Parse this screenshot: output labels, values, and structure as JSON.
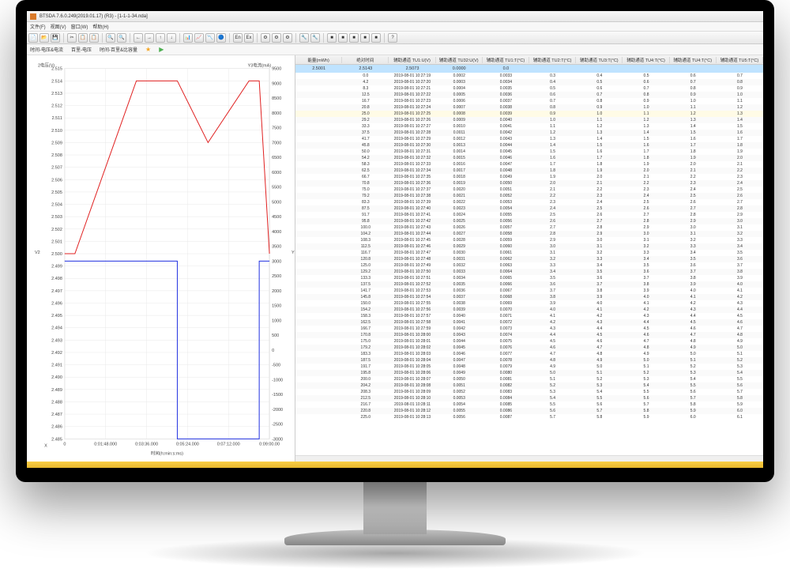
{
  "window": {
    "title": "BTSDA 7.6.0.249(2019.01.17) (R3) - [1-1-1-34.nda]"
  },
  "menus": [
    "文件(F)",
    "视图(V)",
    "窗口(W)",
    "帮助(H)"
  ],
  "subbar": {
    "a": "时间-电压&电流",
    "b": "百里-电压",
    "c": "时间-百里&比容量"
  },
  "chart": {
    "y2_title": "2电压(V)",
    "y3_title": "Y3电流(mA)",
    "x_title": "时间(h:min:s:ms)",
    "v2": "V2",
    "v3": "Y3",
    "x": "X",
    "x_ticks": [
      "0",
      "0:01:48.000",
      "0:03:36.000",
      "0:05:24.000",
      "0:07:12.000",
      "0:09:00.00"
    ],
    "y2_ticks": [
      "2.485",
      "2.486",
      "2.487",
      "2.488",
      "2.489",
      "2.490",
      "2.491",
      "2.492",
      "2.493",
      "2.494",
      "2.495",
      "2.496",
      "2.497",
      "2.498",
      "2.499",
      "2.500",
      "2.501",
      "2.502",
      "2.503",
      "2.504",
      "2.505",
      "2.506",
      "2.507",
      "2.508",
      "2.509",
      "2.510",
      "2.511",
      "2.512",
      "2.513",
      "2.514",
      "2.515"
    ],
    "y3_ticks": [
      "-3000",
      "-2500",
      "-2000",
      "-1500",
      "-1000",
      "-500",
      "0",
      "500",
      "1000",
      "1500",
      "2000",
      "2500",
      "3000",
      "3500",
      "4000",
      "4500",
      "5000",
      "5500",
      "6000",
      "6500",
      "7000",
      "7500",
      "8000",
      "8500",
      "9000",
      "9500"
    ]
  },
  "chart_data": {
    "type": "line",
    "x": [
      0,
      0.05,
      0.35,
      0.55,
      0.7,
      0.9,
      0.95,
      1.0
    ],
    "series": [
      {
        "name": "电压(V)",
        "y": [
          2.5,
          2.5,
          2.514,
          2.514,
          2.509,
          2.514,
          2.514,
          2.5
        ],
        "axis": "left",
        "color": "#e02020"
      },
      {
        "name": "电流(mA)",
        "y": [
          3000,
          3000,
          3000,
          -3000,
          -3000,
          -3000,
          3000,
          3000
        ],
        "axis": "right",
        "color": "#2030e0",
        "shape": "step"
      }
    ],
    "y_left": {
      "min": 2.485,
      "max": 2.515,
      "label": "电压(V)"
    },
    "y_right": {
      "min": -3000,
      "max": 9500,
      "label": "电流(mA)"
    },
    "xlim": [
      0,
      1
    ],
    "xlabel": "时间(h:min:s:ms)"
  },
  "table": {
    "headers": [
      "能量(mWh)",
      "绝对时间",
      "辅助通道 TU1:U(V)",
      "辅助通道 TU32:U(V)",
      "辅助通道 TU1:T(°C)",
      "辅助通道 TU2:T(°C)",
      "辅助通道 TU3:T(°C)",
      "辅助通道 TU4:T(°C)",
      "辅助通道 TU4:T(°C)",
      "辅助通道 TU5:T(°C)"
    ],
    "summary": [
      "2.5001",
      "2.5143",
      "2.5073",
      "0.0000",
      "0.0",
      "",
      "",
      "",
      "",
      ""
    ],
    "hl_index": 6,
    "rows": [
      [
        "0.0",
        "2019-08-01 10:27:19",
        "0.0002",
        "0.0033",
        "0.3",
        "0.4",
        "0.5",
        "0.6",
        "0.7"
      ],
      [
        "4.2",
        "2019-08-01 10:27:20",
        "0.0003",
        "0.0034",
        "0.4",
        "0.5",
        "0.6",
        "0.7",
        "0.8"
      ],
      [
        "8.3",
        "2019-08-01 10:27:21",
        "0.0004",
        "0.0035",
        "0.5",
        "0.6",
        "0.7",
        "0.8",
        "0.9"
      ],
      [
        "12.5",
        "2019-08-01 10:27:22",
        "0.0005",
        "0.0036",
        "0.6",
        "0.7",
        "0.8",
        "0.9",
        "1.0"
      ],
      [
        "16.7",
        "2019-08-01 10:27:23",
        "0.0006",
        "0.0037",
        "0.7",
        "0.8",
        "0.9",
        "1.0",
        "1.1"
      ],
      [
        "20.8",
        "2019-08-01 10:27:24",
        "0.0007",
        "0.0038",
        "0.8",
        "0.9",
        "1.0",
        "1.1",
        "1.2"
      ],
      [
        "25.0",
        "2019-08-01 10:27:25",
        "0.0008",
        "0.0039",
        "0.9",
        "1.0",
        "1.1",
        "1.2",
        "1.3"
      ],
      [
        "29.2",
        "2019-08-01 10:27:26",
        "0.0009",
        "0.0040",
        "1.0",
        "1.1",
        "1.2",
        "1.3",
        "1.4"
      ],
      [
        "33.3",
        "2019-08-01 10:27:27",
        "0.0010",
        "0.0041",
        "1.1",
        "1.2",
        "1.3",
        "1.4",
        "1.5"
      ],
      [
        "37.5",
        "2019-08-01 10:27:28",
        "0.0011",
        "0.0042",
        "1.2",
        "1.3",
        "1.4",
        "1.5",
        "1.6"
      ],
      [
        "41.7",
        "2019-08-01 10:27:29",
        "0.0012",
        "0.0043",
        "1.3",
        "1.4",
        "1.5",
        "1.6",
        "1.7"
      ],
      [
        "45.8",
        "2019-08-01 10:27:30",
        "0.0013",
        "0.0044",
        "1.4",
        "1.5",
        "1.6",
        "1.7",
        "1.8"
      ],
      [
        "50.0",
        "2019-08-01 10:27:31",
        "0.0014",
        "0.0045",
        "1.5",
        "1.6",
        "1.7",
        "1.8",
        "1.9"
      ],
      [
        "54.2",
        "2019-08-01 10:27:32",
        "0.0015",
        "0.0046",
        "1.6",
        "1.7",
        "1.8",
        "1.9",
        "2.0"
      ],
      [
        "58.3",
        "2019-08-01 10:27:33",
        "0.0016",
        "0.0047",
        "1.7",
        "1.8",
        "1.9",
        "2.0",
        "2.1"
      ],
      [
        "62.5",
        "2019-08-01 10:27:34",
        "0.0017",
        "0.0048",
        "1.8",
        "1.9",
        "2.0",
        "2.1",
        "2.2"
      ],
      [
        "66.7",
        "2019-08-01 10:27:35",
        "0.0018",
        "0.0049",
        "1.9",
        "2.0",
        "2.1",
        "2.2",
        "2.3"
      ],
      [
        "70.8",
        "2019-08-01 10:27:36",
        "0.0019",
        "0.0050",
        "2.0",
        "2.1",
        "2.2",
        "2.3",
        "2.4"
      ],
      [
        "75.0",
        "2019-08-01 10:27:37",
        "0.0020",
        "0.0051",
        "2.1",
        "2.2",
        "2.3",
        "2.4",
        "2.5"
      ],
      [
        "79.2",
        "2019-08-01 10:27:38",
        "0.0021",
        "0.0052",
        "2.2",
        "2.3",
        "2.4",
        "2.5",
        "2.6"
      ],
      [
        "83.3",
        "2019-08-01 10:27:39",
        "0.0022",
        "0.0053",
        "2.3",
        "2.4",
        "2.5",
        "2.6",
        "2.7"
      ],
      [
        "87.5",
        "2019-08-01 10:27:40",
        "0.0023",
        "0.0054",
        "2.4",
        "2.5",
        "2.6",
        "2.7",
        "2.8"
      ],
      [
        "91.7",
        "2019-08-01 10:27:41",
        "0.0024",
        "0.0055",
        "2.5",
        "2.6",
        "2.7",
        "2.8",
        "2.9"
      ],
      [
        "95.8",
        "2019-08-01 10:27:42",
        "0.0025",
        "0.0056",
        "2.6",
        "2.7",
        "2.8",
        "2.9",
        "3.0"
      ],
      [
        "100.0",
        "2019-08-01 10:27:43",
        "0.0026",
        "0.0057",
        "2.7",
        "2.8",
        "2.9",
        "3.0",
        "3.1"
      ],
      [
        "104.2",
        "2019-08-01 10:27:44",
        "0.0027",
        "0.0058",
        "2.8",
        "2.9",
        "3.0",
        "3.1",
        "3.2"
      ],
      [
        "108.3",
        "2019-08-01 10:27:45",
        "0.0028",
        "0.0059",
        "2.9",
        "3.0",
        "3.1",
        "3.2",
        "3.3"
      ],
      [
        "112.5",
        "2019-08-01 10:27:46",
        "0.0029",
        "0.0060",
        "3.0",
        "3.1",
        "3.2",
        "3.3",
        "3.4"
      ],
      [
        "116.7",
        "2019-08-01 10:27:47",
        "0.0030",
        "0.0061",
        "3.1",
        "3.2",
        "3.3",
        "3.4",
        "3.5"
      ],
      [
        "120.8",
        "2019-08-01 10:27:48",
        "0.0031",
        "0.0062",
        "3.2",
        "3.3",
        "3.4",
        "3.5",
        "3.6"
      ],
      [
        "125.0",
        "2019-08-01 10:27:49",
        "0.0032",
        "0.0063",
        "3.3",
        "3.4",
        "3.5",
        "3.6",
        "3.7"
      ],
      [
        "129.2",
        "2019-08-01 10:27:50",
        "0.0033",
        "0.0064",
        "3.4",
        "3.5",
        "3.6",
        "3.7",
        "3.8"
      ],
      [
        "133.3",
        "2019-08-01 10:27:51",
        "0.0034",
        "0.0065",
        "3.5",
        "3.6",
        "3.7",
        "3.8",
        "3.9"
      ],
      [
        "137.5",
        "2019-08-01 10:27:52",
        "0.0035",
        "0.0066",
        "3.6",
        "3.7",
        "3.8",
        "3.9",
        "4.0"
      ],
      [
        "141.7",
        "2019-08-01 10:27:53",
        "0.0036",
        "0.0067",
        "3.7",
        "3.8",
        "3.9",
        "4.0",
        "4.1"
      ],
      [
        "145.8",
        "2019-08-01 10:27:54",
        "0.0037",
        "0.0068",
        "3.8",
        "3.9",
        "4.0",
        "4.1",
        "4.2"
      ],
      [
        "150.0",
        "2019-08-01 10:27:55",
        "0.0038",
        "0.0069",
        "3.9",
        "4.0",
        "4.1",
        "4.2",
        "4.3"
      ],
      [
        "154.2",
        "2019-08-01 10:27:56",
        "0.0039",
        "0.0070",
        "4.0",
        "4.1",
        "4.2",
        "4.3",
        "4.4"
      ],
      [
        "158.3",
        "2019-08-01 10:27:57",
        "0.0040",
        "0.0071",
        "4.1",
        "4.2",
        "4.3",
        "4.4",
        "4.5"
      ],
      [
        "162.5",
        "2019-08-01 10:27:58",
        "0.0041",
        "0.0072",
        "4.2",
        "4.3",
        "4.4",
        "4.5",
        "4.6"
      ],
      [
        "166.7",
        "2019-08-01 10:27:59",
        "0.0042",
        "0.0073",
        "4.3",
        "4.4",
        "4.5",
        "4.6",
        "4.7"
      ],
      [
        "170.8",
        "2019-08-01 10:28:00",
        "0.0043",
        "0.0074",
        "4.4",
        "4.5",
        "4.6",
        "4.7",
        "4.8"
      ],
      [
        "175.0",
        "2019-08-01 10:28:01",
        "0.0044",
        "0.0075",
        "4.5",
        "4.6",
        "4.7",
        "4.8",
        "4.9"
      ],
      [
        "179.2",
        "2019-08-01 10:28:02",
        "0.0045",
        "0.0076",
        "4.6",
        "4.7",
        "4.8",
        "4.9",
        "5.0"
      ],
      [
        "183.3",
        "2019-08-01 10:28:03",
        "0.0046",
        "0.0077",
        "4.7",
        "4.8",
        "4.9",
        "5.0",
        "5.1"
      ],
      [
        "187.5",
        "2019-08-01 10:28:04",
        "0.0047",
        "0.0078",
        "4.8",
        "4.9",
        "5.0",
        "5.1",
        "5.2"
      ],
      [
        "191.7",
        "2019-08-01 10:28:05",
        "0.0048",
        "0.0079",
        "4.9",
        "5.0",
        "5.1",
        "5.2",
        "5.3"
      ],
      [
        "195.8",
        "2019-08-01 10:28:06",
        "0.0049",
        "0.0080",
        "5.0",
        "5.1",
        "5.2",
        "5.3",
        "5.4"
      ],
      [
        "200.0",
        "2019-08-01 10:28:07",
        "0.0050",
        "0.0081",
        "5.1",
        "5.2",
        "5.3",
        "5.4",
        "5.5"
      ],
      [
        "204.2",
        "2019-08-01 10:28:08",
        "0.0051",
        "0.0082",
        "5.2",
        "5.3",
        "5.4",
        "5.5",
        "5.6"
      ],
      [
        "208.3",
        "2019-08-01 10:28:09",
        "0.0052",
        "0.0083",
        "5.3",
        "5.4",
        "5.5",
        "5.6",
        "5.7"
      ],
      [
        "212.5",
        "2019-08-01 10:28:10",
        "0.0053",
        "0.0084",
        "5.4",
        "5.5",
        "5.6",
        "5.7",
        "5.8"
      ],
      [
        "216.7",
        "2019-08-01 10:28:11",
        "0.0054",
        "0.0085",
        "5.5",
        "5.6",
        "5.7",
        "5.8",
        "5.9"
      ],
      [
        "220.8",
        "2019-08-01 10:28:12",
        "0.0055",
        "0.0086",
        "5.6",
        "5.7",
        "5.8",
        "5.9",
        "6.0"
      ],
      [
        "225.0",
        "2019-08-01 10:28:13",
        "0.0056",
        "0.0087",
        "5.7",
        "5.8",
        "5.9",
        "6.0",
        "6.1"
      ]
    ]
  }
}
